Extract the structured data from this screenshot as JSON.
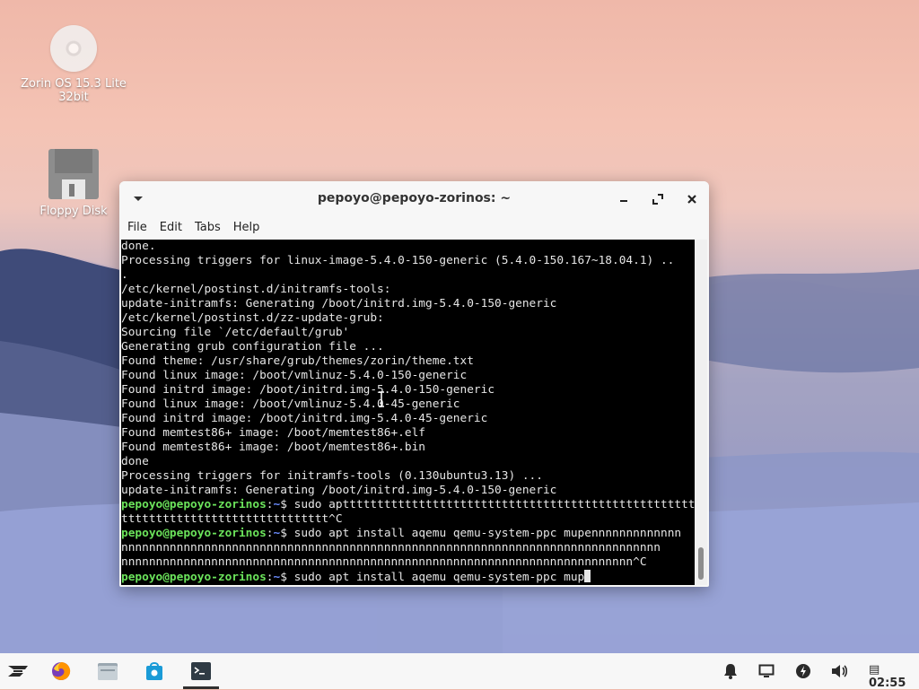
{
  "desktop": {
    "icons": [
      {
        "label_line1": "Zorin OS 15.3 Lite",
        "label_line2": "32bit"
      },
      {
        "label_line1": "Floppy Disk"
      }
    ]
  },
  "window": {
    "title": "pepoyo@pepoyo-zorinos: ~",
    "menu": [
      "File",
      "Edit",
      "Tabs",
      "Help"
    ]
  },
  "terminal": {
    "lines": [
      "done.",
      "Processing triggers for linux-image-5.4.0-150-generic (5.4.0-150.167~18.04.1) ..",
      ".",
      "/etc/kernel/postinst.d/initramfs-tools:",
      "update-initramfs: Generating /boot/initrd.img-5.4.0-150-generic",
      "/etc/kernel/postinst.d/zz-update-grub:",
      "Sourcing file `/etc/default/grub'",
      "Generating grub configuration file ...",
      "Found theme: /usr/share/grub/themes/zorin/theme.txt",
      "Found linux image: /boot/vmlinuz-5.4.0-150-generic",
      "Found initrd image: /boot/initrd.img-5.4.0-150-generic",
      "Found linux image: /boot/vmlinuz-5.4.0-45-generic",
      "Found initrd image: /boot/initrd.img-5.4.0-45-generic",
      "Found memtest86+ image: /boot/memtest86+.elf",
      "Found memtest86+ image: /boot/memtest86+.bin",
      "done",
      "Processing triggers for initramfs-tools (0.130ubuntu3.13) ...",
      "update-initramfs: Generating /boot/initrd.img-5.4.0-150-generic"
    ],
    "prompt_user": "pepoyo@pepoyo-zorinos",
    "prompt_sep": ":",
    "prompt_path": "~",
    "prompt_end": "$ ",
    "cmd1": "sudo apttttttttttttttttttttttttttttttttttttttttttttttttttt",
    "cmd1_cont": "tttttttttttttttttttttttttttttt^C",
    "cmd2": "sudo apt install aqemu qemu-system-ppc mupennnnnnnnnnnnn",
    "cmd2_cont1": "nnnnnnnnnnnnnnnnnnnnnnnnnnnnnnnnnnnnnnnnnnnnnnnnnnnnnnnnnnnnnnnnnnnnnnnnnnnnnn",
    "cmd2_cont2": "nnnnnnnnnnnnnnnnnnnnnnnnnnnnnnnnnnnnnnnnnnnnnnnnnnnnnnnnnnnnnnnnnnnnnnnnnn^C",
    "cmd3": "sudo apt install aqemu qemu-system-ppc mup"
  },
  "taskbar": {
    "apps": [
      "zorin-menu-icon",
      "firefox-icon",
      "files-icon",
      "software-store-icon",
      "terminal-icon"
    ],
    "tray": [
      "notifications-icon",
      "display-icon",
      "power-icon",
      "volume-icon"
    ],
    "clock": "02:55"
  },
  "colors": {
    "prompt_user": "#6be35b",
    "prompt_path": "#6b8cff",
    "terminal_bg": "#000000",
    "accent": "#1a9bd7"
  }
}
